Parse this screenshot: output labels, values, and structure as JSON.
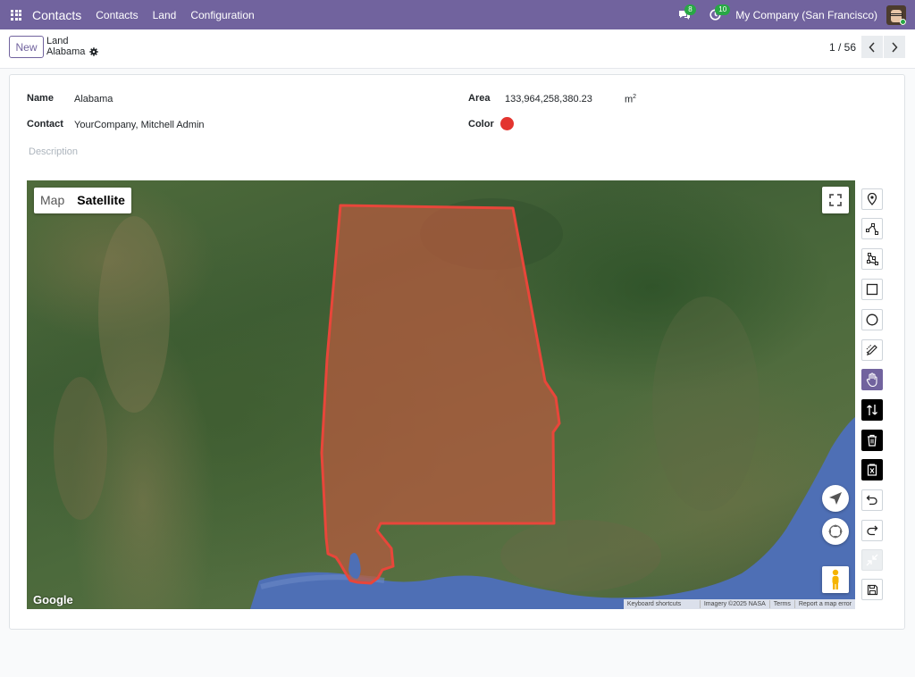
{
  "navbar": {
    "app_name": "Contacts",
    "menu": [
      "Contacts",
      "Land",
      "Configuration"
    ],
    "messages_count": "8",
    "activities_count": "10",
    "company": "My Company (San Francisco)"
  },
  "control": {
    "new_label": "New",
    "breadcrumb_parent": "Land",
    "breadcrumb_current": "Alabama",
    "pager": "1 / 56"
  },
  "form": {
    "name_label": "Name",
    "name_value": "Alabama",
    "contact_label": "Contact",
    "contact_value": "YourCompany, Mitchell Admin",
    "area_label": "Area",
    "area_value": "133,964,258,380.23",
    "area_unit": "m",
    "area_unit_sup": "2",
    "color_label": "Color",
    "color_value": "#e3342f",
    "description_placeholder": "Description"
  },
  "map": {
    "type_map": "Map",
    "type_satellite": "Satellite",
    "selected_type": "Satellite",
    "logo": "Google",
    "attribution": [
      "Keyboard shortcuts",
      "Imagery ©2025 NASA",
      "Terms",
      "Report a map error"
    ],
    "polygon_stroke": "#e8463a",
    "polygon_fill": "#b85a3f"
  },
  "toolbar": {
    "tools": [
      {
        "icon": "marker-icon",
        "state": "normal"
      },
      {
        "icon": "polyline-icon",
        "state": "normal"
      },
      {
        "icon": "polygon-icon",
        "state": "normal"
      },
      {
        "icon": "rectangle-icon",
        "state": "normal"
      },
      {
        "icon": "circle-icon",
        "state": "normal"
      },
      {
        "icon": "edit-pen-icon",
        "state": "normal"
      },
      {
        "icon": "hand-icon",
        "state": "active"
      },
      {
        "icon": "move-vertices-icon",
        "state": "dark"
      },
      {
        "icon": "trash-icon",
        "state": "dark"
      },
      {
        "icon": "clear-icon",
        "state": "dark"
      },
      {
        "icon": "undo-icon",
        "state": "normal"
      },
      {
        "icon": "redo-icon",
        "state": "normal"
      },
      {
        "icon": "collapse-icon",
        "state": "disabled"
      },
      {
        "icon": "save-icon",
        "state": "normal"
      }
    ]
  }
}
